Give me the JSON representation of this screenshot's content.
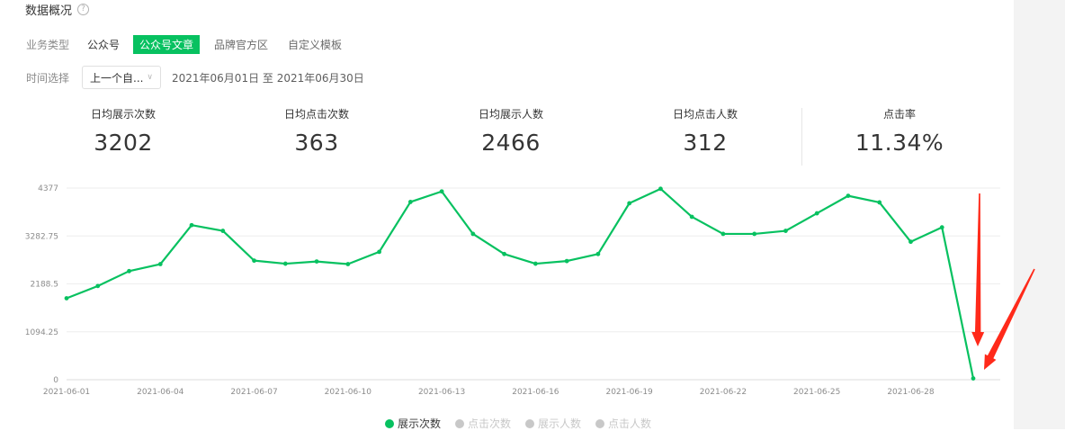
{
  "header": {
    "title": "数据概况",
    "help_icon": "question-circle-icon"
  },
  "filters": {
    "type_label": "业务类型",
    "tabs": [
      {
        "label": "公众号",
        "active": false
      },
      {
        "label": "公众号文章",
        "active": true
      },
      {
        "label": "品牌官方区",
        "active": false
      },
      {
        "label": "自定义模板",
        "active": false
      }
    ],
    "time_label": "时间选择",
    "time_select": "上一个自...",
    "date_range": "2021年06月01日 至 2021年06月30日"
  },
  "stats": [
    {
      "label": "日均展示次数",
      "value": "3202"
    },
    {
      "label": "日均点击次数",
      "value": "363"
    },
    {
      "label": "日均展示人数",
      "value": "2466"
    },
    {
      "label": "日均点击人数",
      "value": "312"
    },
    {
      "label": "点击率",
      "value": "11.34%"
    }
  ],
  "colors": {
    "accent": "#07c160",
    "annotation": "#ff2a1a",
    "legend_inactive": "#c8c8c8"
  },
  "chart_data": {
    "type": "line",
    "ylim": [
      0,
      4377
    ],
    "ytick_labels": [
      "0",
      "1094.25",
      "2188.5",
      "3282.75",
      "4377"
    ],
    "xtick_labels": [
      "2021-06-01",
      "2021-06-04",
      "2021-06-07",
      "2021-06-10",
      "2021-06-13",
      "2021-06-16",
      "2021-06-19",
      "2021-06-22",
      "2021-06-25",
      "2021-06-28"
    ],
    "x": [
      "2021-06-01",
      "2021-06-02",
      "2021-06-03",
      "2021-06-04",
      "2021-06-05",
      "2021-06-06",
      "2021-06-07",
      "2021-06-08",
      "2021-06-09",
      "2021-06-10",
      "2021-06-11",
      "2021-06-12",
      "2021-06-13",
      "2021-06-14",
      "2021-06-15",
      "2021-06-16",
      "2021-06-17",
      "2021-06-18",
      "2021-06-19",
      "2021-06-20",
      "2021-06-21",
      "2021-06-22",
      "2021-06-23",
      "2021-06-24",
      "2021-06-25",
      "2021-06-26",
      "2021-06-27",
      "2021-06-28",
      "2021-06-29",
      "2021-06-30"
    ],
    "series": [
      {
        "name": "展示次数",
        "active": true,
        "values": [
          1860,
          2140,
          2480,
          2640,
          3530,
          3400,
          2720,
          2650,
          2700,
          2640,
          2920,
          4060,
          4300,
          3330,
          2870,
          2650,
          2710,
          2870,
          4030,
          4360,
          3720,
          3330,
          3330,
          3400,
          3800,
          4200,
          4050,
          3150,
          3480,
          30
        ]
      },
      {
        "name": "点击次数",
        "active": false
      },
      {
        "name": "展示人数",
        "active": false
      },
      {
        "name": "点击人数",
        "active": false
      }
    ],
    "grid": true,
    "legend_position": "bottom"
  }
}
